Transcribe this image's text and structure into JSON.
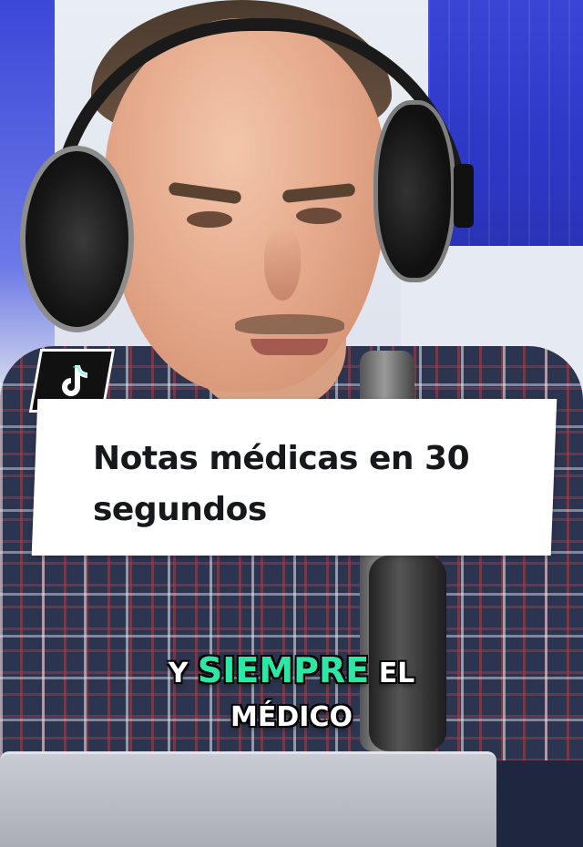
{
  "video": {
    "platform_icon": "tiktok-icon",
    "title_card": {
      "text": "Notas médicas en 30 segundos"
    },
    "caption": {
      "line1_prefix": "Y",
      "line1_highlight": "SIEMPRE",
      "line1_suffix": "EL",
      "line2": "MÉDICO",
      "highlight_color": "#2ee6a6"
    }
  },
  "colors": {
    "accent_blue": "#3a45d6",
    "card_bg": "#ffffff",
    "caption_text": "#ffffff"
  }
}
